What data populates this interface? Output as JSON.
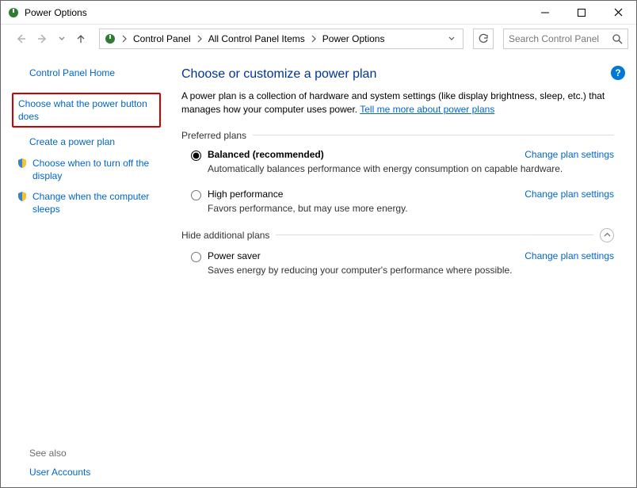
{
  "window": {
    "title": "Power Options"
  },
  "breadcrumb": {
    "items": [
      "Control Panel",
      "All Control Panel Items",
      "Power Options"
    ]
  },
  "search": {
    "placeholder": "Search Control Panel"
  },
  "sidebar": {
    "home": "Control Panel Home",
    "items": [
      {
        "label": "Choose what the power button does",
        "highlighted": true
      },
      {
        "label": "Create a power plan"
      },
      {
        "label": "Choose when to turn off the display"
      },
      {
        "label": "Change when the computer sleeps"
      }
    ],
    "see_also_label": "See also",
    "related": [
      "User Accounts"
    ]
  },
  "main": {
    "title": "Choose or customize a power plan",
    "description_prefix": "A power plan is a collection of hardware and system settings (like display brightness, sleep, etc.) that manages how your computer uses power. ",
    "description_link": "Tell me more about power plans",
    "preferred_label": "Preferred plans",
    "hidden_label": "Hide additional plans",
    "change_link": "Change plan settings",
    "plans_preferred": [
      {
        "name": "Balanced (recommended)",
        "desc": "Automatically balances performance with energy consumption on capable hardware.",
        "selected": true
      },
      {
        "name": "High performance",
        "desc": "Favors performance, but may use more energy.",
        "selected": false
      }
    ],
    "plans_hidden": [
      {
        "name": "Power saver",
        "desc": "Saves energy by reducing your computer's performance where possible.",
        "selected": false
      }
    ]
  }
}
